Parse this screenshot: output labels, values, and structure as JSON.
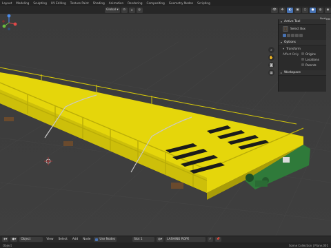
{
  "workspace_tabs": [
    "Layout",
    "Modeling",
    "Sculpting",
    "UV Editing",
    "Texture Paint",
    "Shading",
    "Animation",
    "Rendering",
    "Compositing",
    "Geometry Nodes",
    "Scripting"
  ],
  "header": {
    "orientation": "Global"
  },
  "npanel": {
    "active_tool_title": "Active Tool",
    "tool_name": "Select Box",
    "options_title": "Options",
    "transform_title": "Transform",
    "affect_only_label": "Affect Only",
    "affect_only_items": [
      "Origins",
      "Locations",
      "Parents"
    ],
    "workspace_title": "Workspace",
    "tab_label": "Options"
  },
  "bottom": {
    "mode": "Object",
    "menus": [
      "View",
      "Select",
      "Add",
      "Node"
    ],
    "use_nodes": "Use Nodes",
    "slot": "Slot 1",
    "material": "LASHING ROPE"
  },
  "status": {
    "left": "Object",
    "right": "Scene Collection | Plane.001"
  },
  "colors": {
    "beam_yellow": "#e5d60b",
    "accent_blue": "#4772b3",
    "endcarriage_green": "#2f7a3a"
  },
  "icons": [
    "grid-icon",
    "hand-icon",
    "zoom-icon",
    "camera-icon",
    "cursor-icon"
  ]
}
